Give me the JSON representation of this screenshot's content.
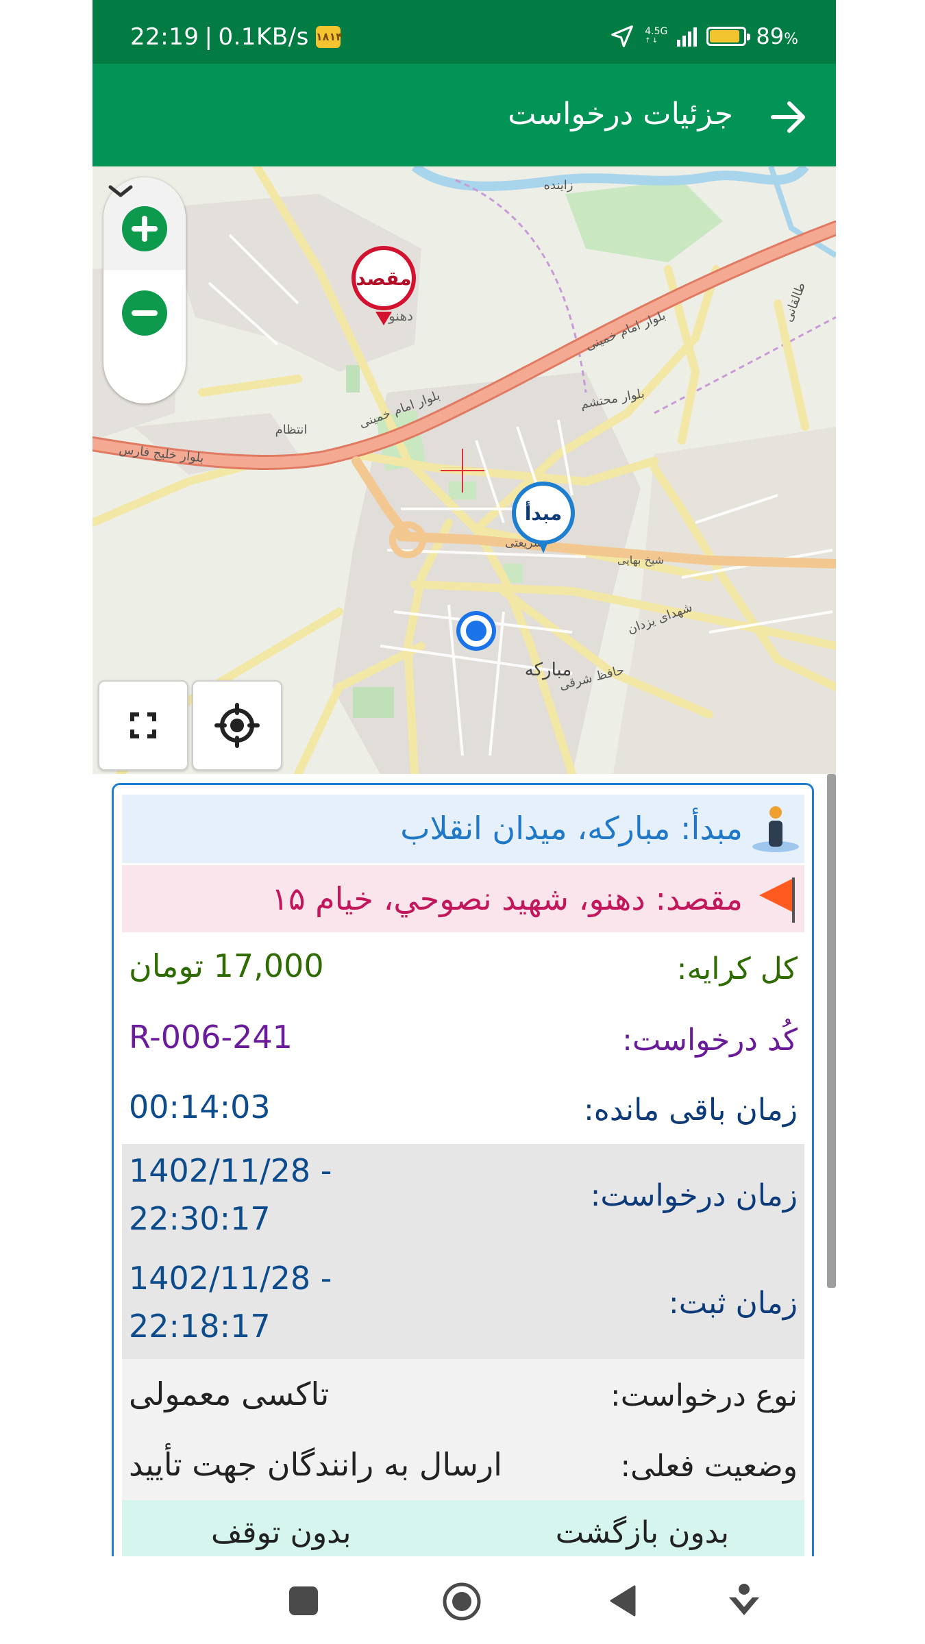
{
  "status_bar": {
    "time": "22:19",
    "separator": "|",
    "network_speed": "0.1KB/s",
    "operator_badge": "۱۸۱۴",
    "network_type": "4.5G",
    "battery": "89",
    "battery_unit": "%",
    "battery_level": 0.89
  },
  "app_bar": {
    "title": "جزئیات درخواست",
    "back_icon": "arrow-right-icon"
  },
  "map": {
    "origin_pin": "مبدأ",
    "destination_pin": "مقصد",
    "labels": {
      "mobarakeh": "مبارکه",
      "dehnow": "دهنو",
      "zayandeh": "زاینده",
      "blvd_khomeini": "بلوار امام خمینی",
      "blvd_khalij": "بلوار خلیج فارس",
      "blvd_mohtasham": "بلوار محتشم",
      "shariati": "شریعتی",
      "hafez_sharghi": "حافظ شرقی",
      "shohada_yazdan": "شهدای یزدان",
      "entezam": "انتظام",
      "taleghani": "طالقانی",
      "sheikh_bahayi": "شیخ بهایی"
    },
    "colors": {
      "main_road": "#ee9a84",
      "secondary_road": "#f2e7a4",
      "river": "#a8d4ec",
      "green": "#c9e8c2",
      "primary": "#029456",
      "origin": "#1e7fd1",
      "destination": "#d3122f"
    }
  },
  "details": {
    "origin_label": "مبدأ:",
    "origin_value": "مبارکه، میدان انقلاب",
    "destination_label": "مقصد:",
    "destination_value": "دهنو، شهید نصوحي، خیام ۱۵",
    "fare_label": "کل کرایه:",
    "fare_value": "17,000 تومان",
    "code_label": "کُد درخواست:",
    "code_value": "R-006-241",
    "remaining_label": "زمان باقی مانده:",
    "remaining_value": "00:14:03",
    "request_time_label": "زمان درخواست:",
    "request_time_date": "1402/11/28 -",
    "request_time_clock": "22:30:17",
    "register_time_label": "زمان ثبت:",
    "register_time_date": "1402/11/28 -",
    "register_time_clock": "22:18:17",
    "type_label": "نوع درخواست:",
    "type_value": "تاکسی معمولی",
    "status_label": "وضعیت فعلی:",
    "status_value": "ارسال به رانندگان جهت تأیید",
    "option_return": "بدون بازگشت",
    "option_stop": "بدون توقف"
  }
}
